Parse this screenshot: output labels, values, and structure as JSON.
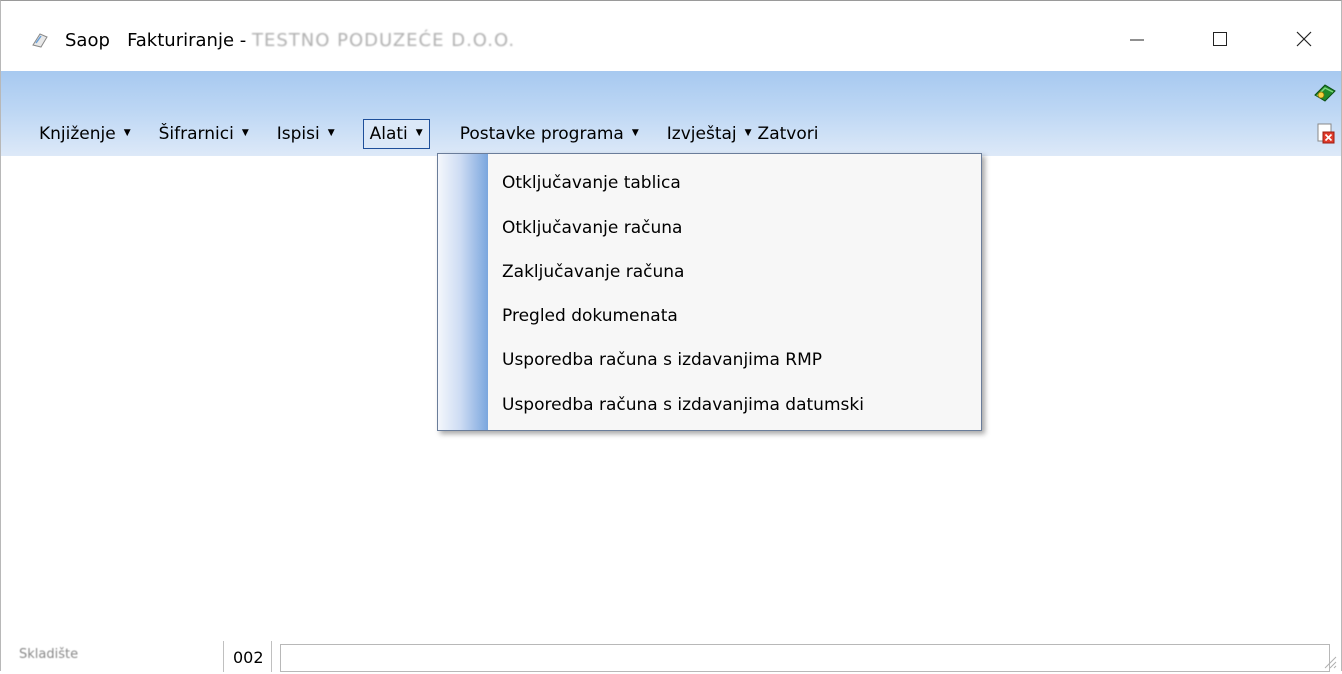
{
  "window": {
    "app_name": "Saop",
    "title_text": "Fakturiranje -",
    "company_blurred": "TESTNO PODUZEĆE D.O.O.",
    "controls": {
      "minimize": "—",
      "maximize": "☐",
      "close": "✕"
    }
  },
  "menubar": {
    "items": [
      {
        "label": "Knjiženje",
        "has_arrow": true
      },
      {
        "label": "Šifrarnici",
        "has_arrow": true
      },
      {
        "label": "Ispisi",
        "has_arrow": true
      },
      {
        "label": "Alati",
        "has_arrow": true,
        "active": true
      },
      {
        "label": "Postavke programa",
        "has_arrow": true
      },
      {
        "label": "Izvještaj",
        "has_arrow": true
      },
      {
        "label": "Zatvori",
        "has_arrow": false
      }
    ],
    "arrow_glyph": "▼"
  },
  "dropdown": {
    "items": [
      {
        "label": "Otključavanje tablica"
      },
      {
        "label": "Otključavanje računa"
      },
      {
        "label": "Zaključavanje računa"
      },
      {
        "label": "Pregled dokumenata"
      },
      {
        "label": "Usporedba računa s izdavanjima RMP"
      },
      {
        "label": "Usporedba računa s izdavanjima datumski"
      }
    ]
  },
  "statusbar": {
    "label_blurred": "Skladište",
    "code": "002",
    "field_value": ""
  },
  "icons": {
    "app": "app-icon",
    "help": "help-book-icon",
    "exit": "exit-document-icon",
    "grip": "resize-grip-icon"
  },
  "colors": {
    "menuband_top": "#a7c9f0",
    "menuband_bottom": "#dde9f8",
    "active_menu_border": "#1e4f9a",
    "dropdown_gutter": "#7aa6de"
  }
}
